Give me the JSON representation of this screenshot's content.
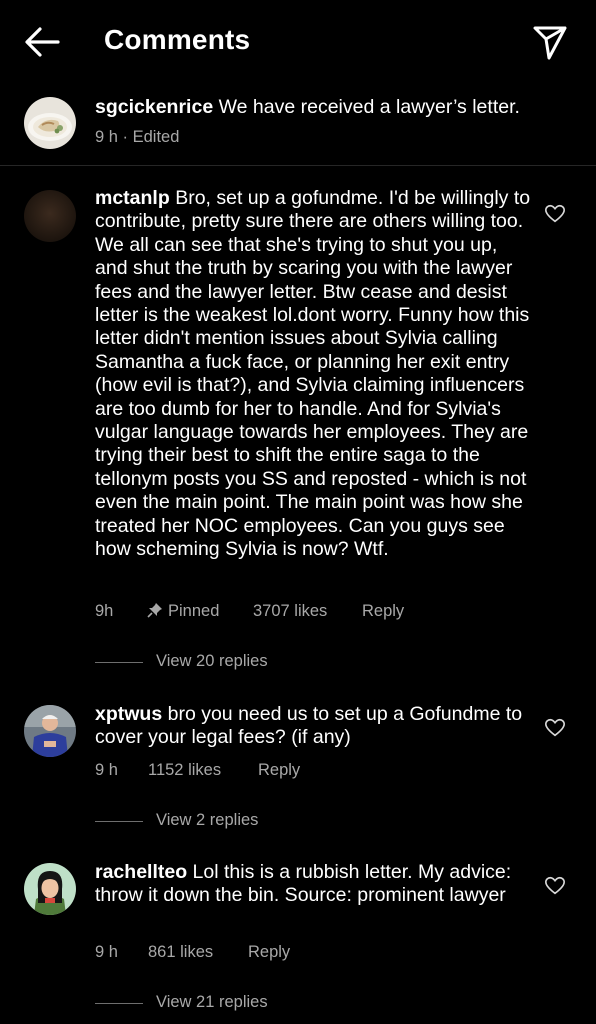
{
  "header": {
    "title": "Comments",
    "back_icon": "arrow-left-icon",
    "share_icon": "paper-plane-icon"
  },
  "caption": {
    "username": "sgcickenrice",
    "text": "We have received a lawyer’s letter.",
    "time": "9 h",
    "separator": "·",
    "edited": "Edited"
  },
  "comments": [
    {
      "username": "mctanlp",
      "text": "Bro, set up a gofundme. I'd be willingly to contribute, pretty sure there are others willing too. We all can see that she's trying to shut you up, and shut the truth by scaring you with the lawyer fees and the lawyer letter. Btw cease and desist letter is the weakest lol.dont worry. Funny how this letter didn't mention issues about Sylvia calling Samantha a fuck face, or planning her exit entry (how evil is that?), and Sylvia claiming influencers are too dumb for her to handle. And for Sylvia's vulgar language towards her employees. They are trying their best to shift the entire saga to the tellonym posts you SS and reposted - which is not even the main point. The main point was how she treated her NOC employees. Can you guys see how scheming Sylvia is now? Wtf.",
      "time": "9h",
      "pinned": "Pinned",
      "likes": "3707 likes",
      "reply": "Reply",
      "view_replies": "View 20 replies"
    },
    {
      "username": "xptwus",
      "text": "bro you need us to set up a Gofundme to cover your legal fees? (if any)",
      "time": "9 h",
      "likes": "1152 likes",
      "reply": "Reply",
      "view_replies": "View 2 replies"
    },
    {
      "username": "rachellteo",
      "text": "Lol this is a rubbish letter. My advice: throw it down the bin. Source: prominent lawyer",
      "time": "9 h",
      "likes": "861 likes",
      "reply": "Reply",
      "view_replies": "View 21 replies"
    }
  ],
  "colors": {
    "background": "#000000",
    "text": "#ffffff",
    "secondary_text": "#a8a8a8",
    "divider": "#262626"
  }
}
